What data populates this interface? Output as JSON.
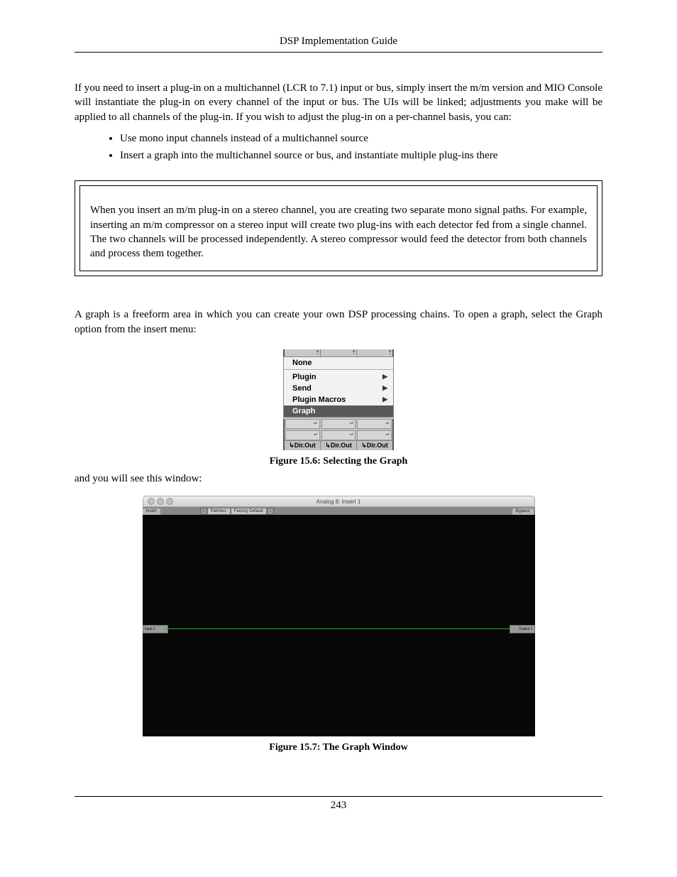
{
  "header": {
    "title": "DSP Implementation Guide"
  },
  "para1": "If you need to insert a plug-in on a multichannel (LCR to 7.1) input or bus, simply insert the m/m version and MIO Console will instantiate the plug-in on every channel of the input or bus. The UIs will be linked; adjustments you make will be applied to all channels of the plug-in. If you wish to adjust the plug-in on a per-channel basis, you can:",
  "bullets": [
    "Use mono input channels instead of a multichannel source",
    "Insert a graph into the multichannel source or bus, and instantiate multiple plug-ins there"
  ],
  "note": "When you insert an m/m plug-in on a stereo channel, you are creating two separate mono signal paths. For example, inserting an m/m compressor on a stereo input will create two plug-ins with each detector fed from a single channel. The two channels will be processed independently. A stereo compressor would feed the detector from both channels and process them together.",
  "para2": "A graph is a freeform area in which you can create your own DSP processing chains. To open a graph, select the Graph option from the insert menu:",
  "fig156": {
    "menu": {
      "none": "None",
      "plugin": "Plugin",
      "send": "Send",
      "macros": "Plugin Macros",
      "graph": "Graph"
    },
    "dirout": "↳Dir.Out",
    "caption": "Figure 15.6: Selecting the Graph"
  },
  "para3": "and you will see this window:",
  "fig157": {
    "title": "Analog 8: Insert 1",
    "insert_tab": "Insert",
    "patches": "Patches:",
    "preset": "Factory Default",
    "bypass": "Bypass",
    "input_node": "Input 1",
    "output_node": "Output 1",
    "caption": "Figure 15.7: The Graph Window"
  },
  "footer": {
    "page": "243"
  }
}
